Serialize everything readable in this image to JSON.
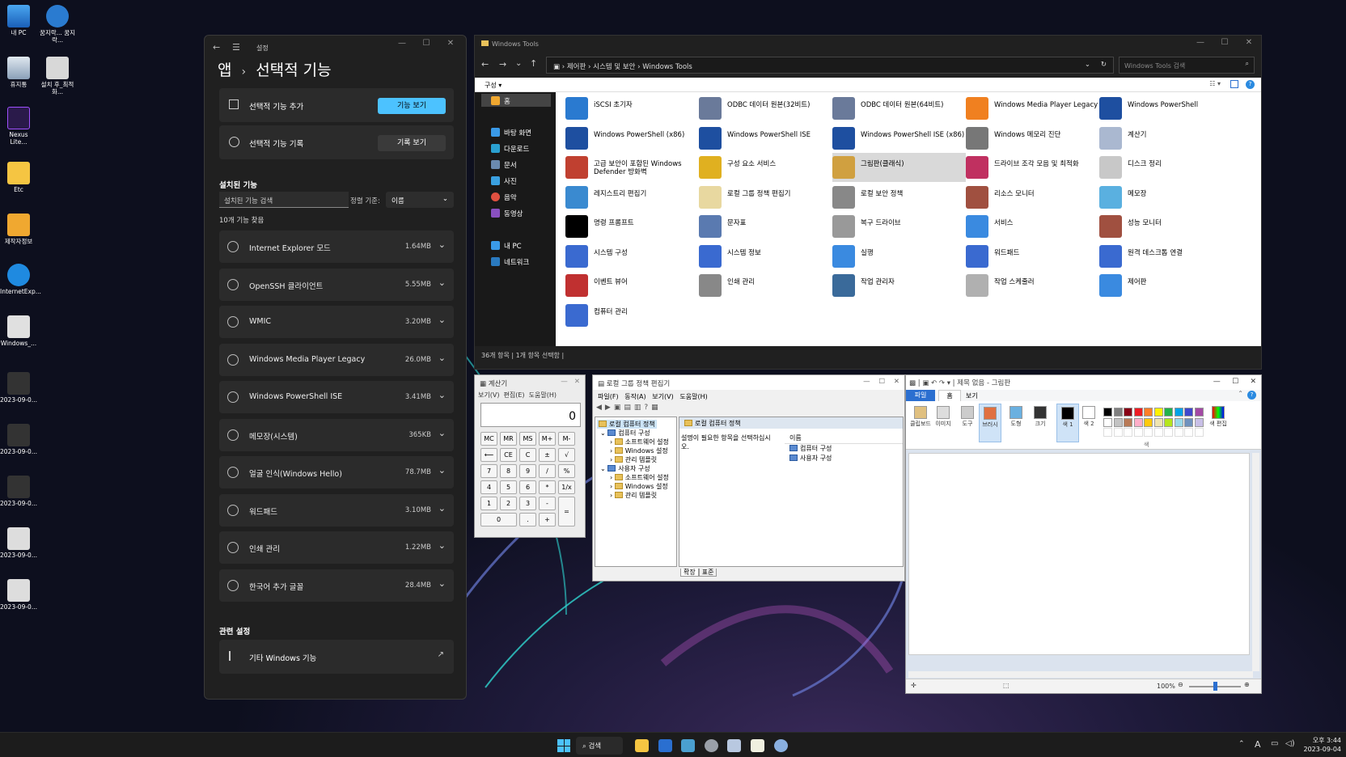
{
  "desktop": {
    "icons": [
      {
        "label": "내 PC"
      },
      {
        "label": "꿈지락... 꿈지락..."
      },
      {
        "label": "휴지통"
      },
      {
        "label": "설치 후_최적화..."
      },
      {
        "label": "Nexus Lite..."
      },
      {
        "label": "Etc"
      },
      {
        "label": "제작자정보"
      },
      {
        "label": "InternetExp..."
      },
      {
        "label": "Windows_..."
      },
      {
        "label": "2023-09-0..."
      },
      {
        "label": "2023-09-0..."
      },
      {
        "label": "2023-09-0..."
      },
      {
        "label": "2023-09-0..."
      },
      {
        "label": "2023-09-0..."
      }
    ]
  },
  "settings": {
    "window_title": "설정",
    "breadcrumb_parent": "앱",
    "breadcrumb_sep": "›",
    "page_title": "선택적 기능",
    "add_feature": {
      "label": "선택적 기능 추가",
      "button": "기능 보기"
    },
    "history": {
      "label": "선택적 기능 기록",
      "button": "기록 보기"
    },
    "installed_heading": "설치된 기능",
    "search_placeholder": "설치된 기능 검색",
    "sort_label": "정렬 기준:",
    "sort_value": "이름",
    "count_text": "10개 기능 찾음",
    "features": [
      {
        "name": "Internet Explorer 모드",
        "size": "1.64MB"
      },
      {
        "name": "OpenSSH 클라이언트",
        "size": "5.55MB"
      },
      {
        "name": "WMIC",
        "size": "3.20MB"
      },
      {
        "name": "Windows Media Player Legacy",
        "size": "26.0MB"
      },
      {
        "name": "Windows PowerShell ISE",
        "size": "3.41MB"
      },
      {
        "name": "메모장(시스템)",
        "size": "365KB"
      },
      {
        "name": "얼굴 인식(Windows Hello)",
        "size": "78.7MB"
      },
      {
        "name": "워드패드",
        "size": "3.10MB"
      },
      {
        "name": "인쇄 관리",
        "size": "1.22MB"
      },
      {
        "name": "한국어 추가 글꼴",
        "size": "28.4MB"
      }
    ],
    "related_heading": "관련 설정",
    "related_item": "기타 Windows 기능"
  },
  "explorer": {
    "title": "Windows Tools",
    "path": [
      "제어판",
      "시스템 및 보안",
      "Windows Tools"
    ],
    "search_placeholder": "Windows Tools 검색",
    "organize": "구성 ▾",
    "nav": {
      "home": "홈",
      "pinned": [
        "바탕 화면",
        "다운로드",
        "문서",
        "사진",
        "음악",
        "동영상"
      ],
      "this_pc": "내 PC",
      "network": "네트워크"
    },
    "tools": [
      "iSCSI 초기자",
      "ODBC 데이터 원본(32비트)",
      "ODBC 데이터 원본(64비트)",
      "Windows Media Player Legacy",
      "Windows PowerShell",
      "Windows PowerShell (x86)",
      "Windows PowerShell ISE",
      "Windows PowerShell ISE (x86)",
      "Windows 메모리 진단",
      "계산기",
      "고급 보안이 포함된 Windows Defender 방화벽",
      "구성 요소 서비스",
      "그림판(클래식)",
      "드라이브 조각 모음 및 최적화",
      "디스크 정리",
      "레지스트리 편집기",
      "로컬 그룹 정책 편집기",
      "로컬 보안 정책",
      "리소스 모니터",
      "메모장",
      "명령 프롬프트",
      "문자표",
      "복구 드라이브",
      "서비스",
      "성능 모니터",
      "시스템 구성",
      "시스템 정보",
      "실행",
      "워드패드",
      "원격 데스크톱 연결",
      "이벤트 뷰어",
      "인쇄 관리",
      "작업 관리자",
      "작업 스케줄러",
      "제어판",
      "컴퓨터 관리"
    ],
    "status": "36개 항목  |  1개 항목 선택함  |"
  },
  "calculator": {
    "title": "계산기",
    "menu": [
      "보기(V)",
      "편집(E)",
      "도움말(H)"
    ],
    "display": "0",
    "keys": [
      [
        "MC",
        "MR",
        "MS",
        "M+",
        "M-"
      ],
      [
        "⟵",
        "CE",
        "C",
        "±",
        "√"
      ],
      [
        "7",
        "8",
        "9",
        "/",
        "%"
      ],
      [
        "4",
        "5",
        "6",
        "*",
        "1/x"
      ],
      [
        "1",
        "2",
        "3",
        "-",
        "="
      ],
      [
        "0",
        ".",
        "+"
      ]
    ]
  },
  "gpedit": {
    "title": "로컬 그룹 정책 편집기",
    "menu": [
      "파일(F)",
      "동작(A)",
      "보기(V)",
      "도움말(H)"
    ],
    "tree_root": "로컬 컴퓨터 정책",
    "computer_config": "컴퓨터 구성",
    "user_config": "사용자 구성",
    "sub_items": [
      "소프트웨어 설정",
      "Windows 설정",
      "관리 템플릿"
    ],
    "right_header": "로컬 컴퓨터 정책",
    "hint": "설명이 필요한 항목을 선택하십시오.",
    "col_name": "이름",
    "right_items": [
      "컴퓨터 구성",
      "사용자 구성"
    ],
    "tabs": [
      "확장",
      "표준"
    ]
  },
  "paint": {
    "title": "제목 없음 - 그림판",
    "tabs": [
      "파일",
      "홈",
      "보기"
    ],
    "groups": [
      "클립보드",
      "이미지",
      "도구",
      "브러시",
      "도형",
      "크기",
      "색 1",
      "색 2",
      "색 편집"
    ],
    "colors_label": "색",
    "zoom": "100%",
    "palette": [
      "#000000",
      "#7f7f7f",
      "#880015",
      "#ed1c24",
      "#ff7f27",
      "#fff200",
      "#22b14c",
      "#00a2e8",
      "#3f48cc",
      "#a349a4",
      "#ffffff",
      "#c3c3c3",
      "#b97a57",
      "#ffaec9",
      "#ffc90e",
      "#efe4b0",
      "#b5e61d",
      "#99d9ea",
      "#7092be",
      "#c8bfe7"
    ]
  },
  "taskbar": {
    "search": "검색",
    "time": "오후 3:44",
    "date": "2023-09-04",
    "ime": "A"
  },
  "colors": {
    "accent": "#4cc2ff",
    "window_dark": "#202020",
    "card_dark": "#2b2b2b",
    "explorer_nav": "#191919",
    "selected": "#d9d9d9"
  }
}
